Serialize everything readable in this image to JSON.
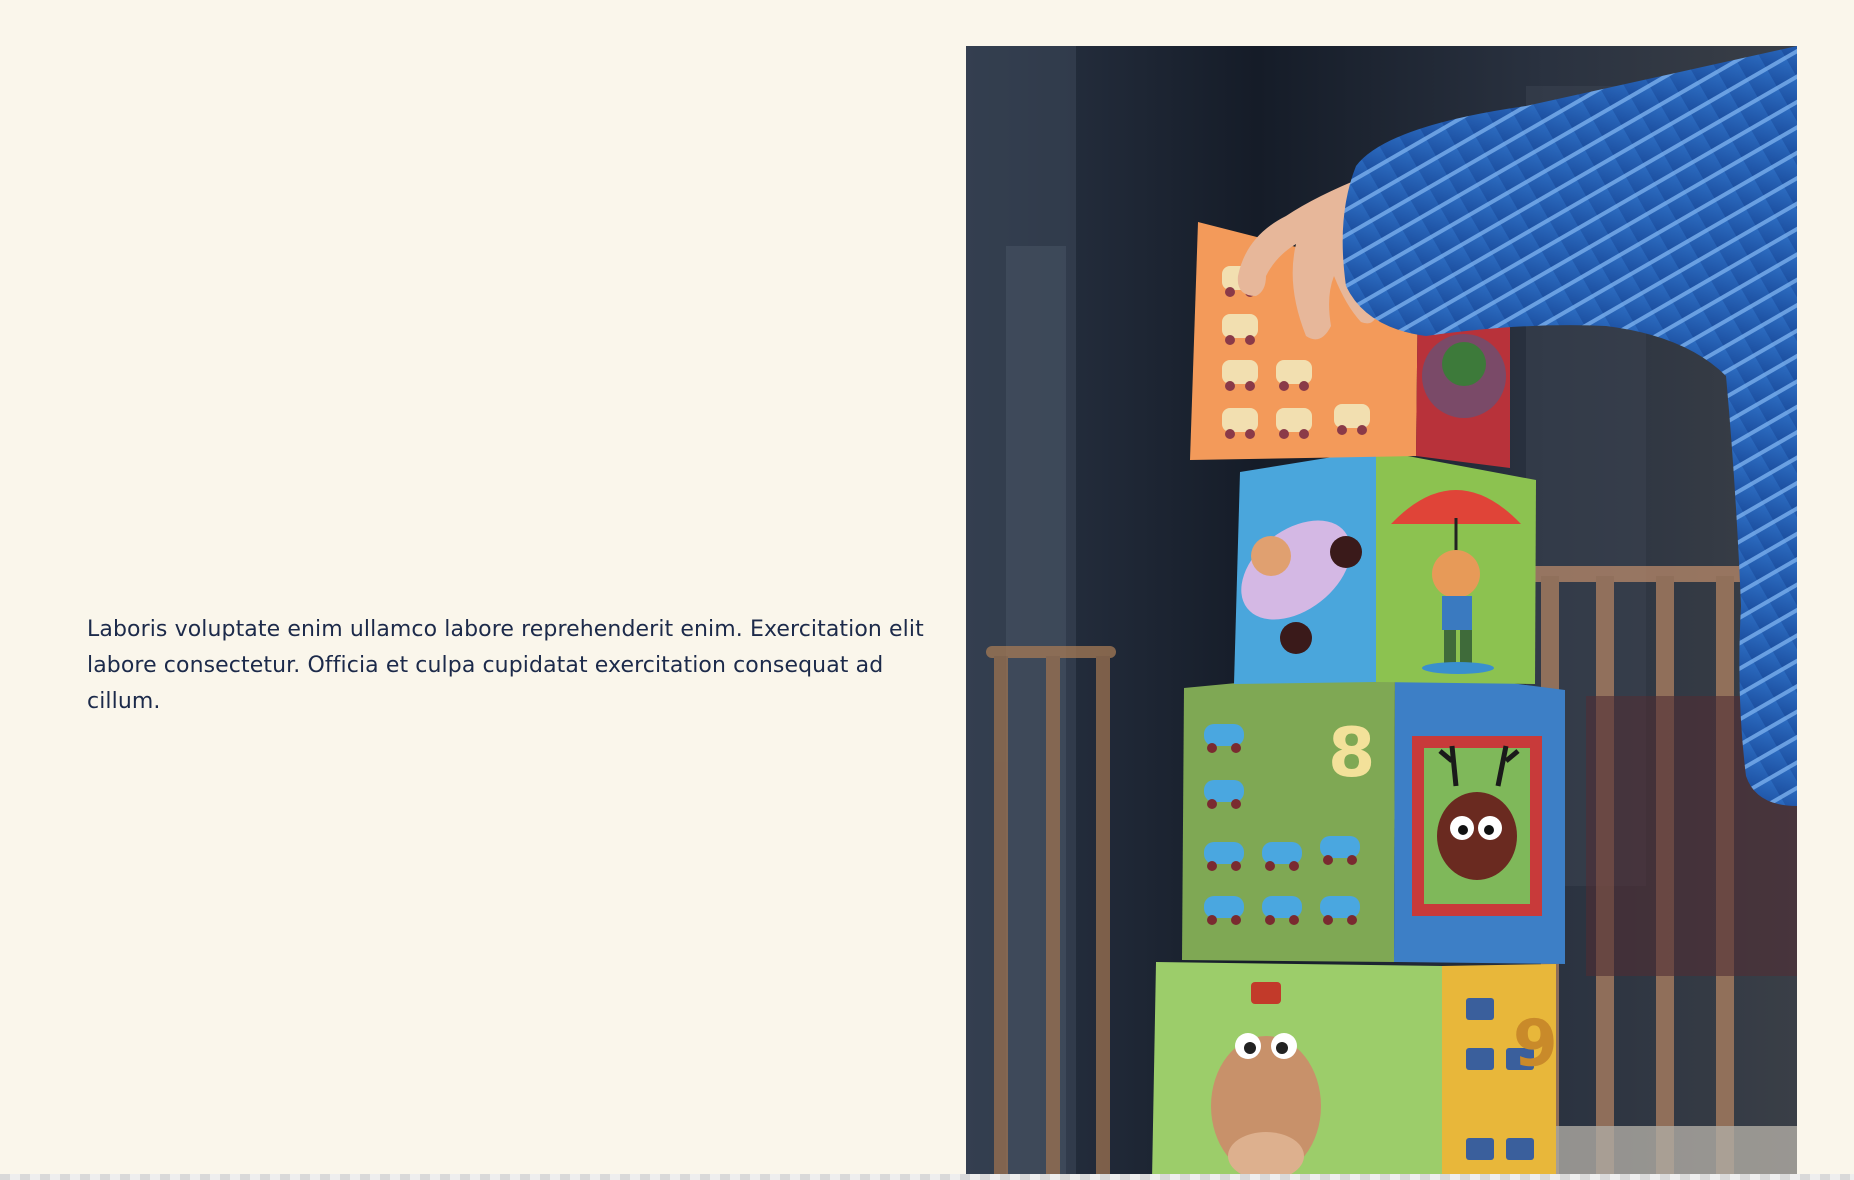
{
  "content": {
    "paragraph": "Laboris voluptate enim ullamco labore reprehenderit enim. Exercitation elit labore consectetur. Officia et culpa cupidatat exercitation consequat ad cillum."
  },
  "photo": {
    "block_numbers": [
      "8",
      "9"
    ]
  }
}
